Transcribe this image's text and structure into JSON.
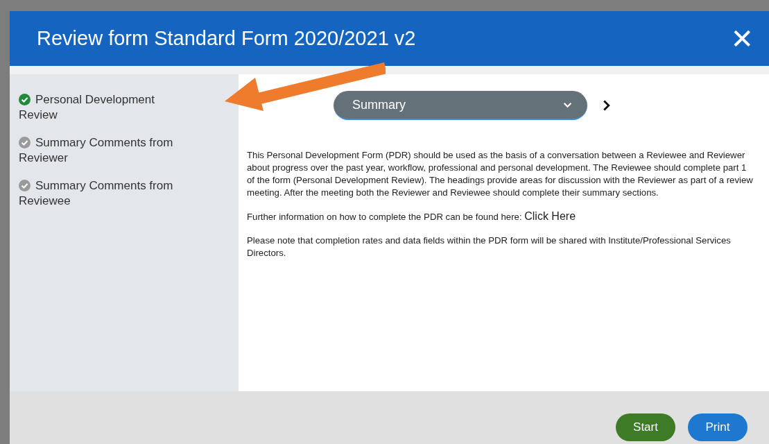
{
  "dialog": {
    "title": "Review form Standard Form 2020/2021 v2",
    "close_icon": "✕"
  },
  "sections": [
    {
      "label": "Personal Development Review",
      "completed": true
    },
    {
      "label": "Summary Comments from Reviewer",
      "completed": false
    },
    {
      "label": "Summary Comments from Reviewee",
      "completed": false
    }
  ],
  "section_select": {
    "value": "Summary"
  },
  "intro": {
    "paragraph": "This Personal Development Form (PDR) should be used as the basis of a conversation between a Reviewee and Reviewer about progress over the past year, workflow, professional and personal development.  The Reviewee should complete part 1 of the form (Personal Development Review).  The headings provide areas for discussion with the Reviewer as part of a review meeting.  After the meeting both the Reviewer and Reviewee should complete their summary sections.",
    "further_info": "Further information on how to complete the PDR can be found here:",
    "link": "Click Here",
    "note": "Please note that completion rates and data fields within the PDR form will be shared with Institute/Professional Services Directors."
  },
  "buttons": [
    {
      "label": "Start",
      "kind": "primary"
    },
    {
      "label": "Print",
      "kind": "secondary"
    }
  ]
}
